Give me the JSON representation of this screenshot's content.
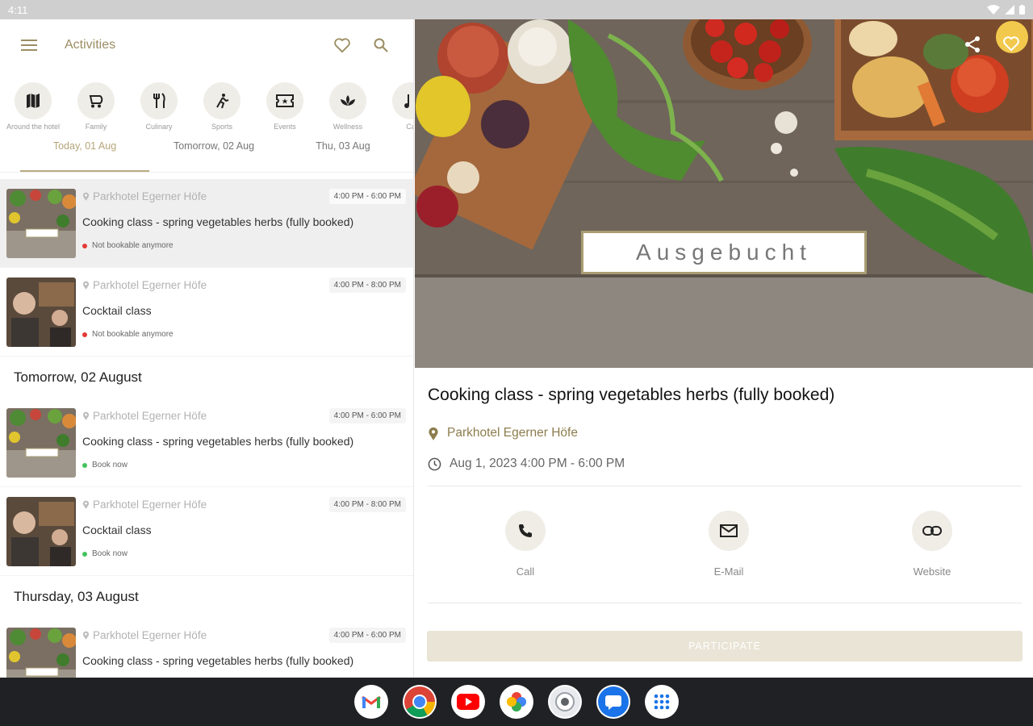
{
  "status_bar": {
    "time": "4:11",
    "icons": [
      "wifi-icon",
      "signal-icon",
      "battery-icon"
    ]
  },
  "header": {
    "title": "Activities",
    "icons": [
      "menu-icon",
      "heart-icon",
      "search-icon"
    ]
  },
  "categories": [
    {
      "label": "Around the hotel",
      "icon": "map-icon"
    },
    {
      "label": "Family",
      "icon": "stroller-icon"
    },
    {
      "label": "Culinary",
      "icon": "cutlery-icon"
    },
    {
      "label": "Sports",
      "icon": "runner-icon"
    },
    {
      "label": "Events",
      "icon": "ticket-icon"
    },
    {
      "label": "Wellness",
      "icon": "lotus-icon"
    },
    {
      "label": "Ca",
      "icon": "music-icon"
    }
  ],
  "day_tabs": [
    "Today, 01 Aug",
    "Tomorrow, 02 Aug",
    "Thu, 03 Aug"
  ],
  "list": {
    "items": [
      {
        "location": "Parkhotel Egerner Höfe",
        "time": "4:00 PM - 6:00 PM",
        "title": "Cooking class - spring vegetables herbs (fully booked)",
        "status": "Not bookable anymore"
      },
      {
        "location": "Parkhotel Egerner Höfe",
        "time": "4:00 PM - 8:00 PM",
        "title": "Cocktail class",
        "status": "Not bookable anymore"
      },
      {
        "location": "Parkhotel Egerner Höfe",
        "time": "4:00 PM - 6:00 PM",
        "title": "Cooking class - spring vegetables herbs (fully booked)",
        "status": "Book now"
      },
      {
        "location": "Parkhotel Egerner Höfe",
        "time": "4:00 PM - 8:00 PM",
        "title": "Cocktail class",
        "status": "Book now"
      },
      {
        "location": "Parkhotel Egerner Höfe",
        "time": "4:00 PM - 6:00 PM",
        "title": "Cooking class - spring vegetables herbs (fully booked)",
        "status": ""
      }
    ],
    "sections": [
      "Tomorrow, 02 August",
      "Thursday, 03 August"
    ]
  },
  "detail": {
    "banner_text": "Ausgebucht",
    "title": "Cooking class - spring vegetables herbs (fully booked)",
    "location": "Parkhotel Egerner Höfe",
    "datetime": "Aug 1, 2023 4:00 PM - 6:00 PM",
    "actions": [
      "Call",
      "E-Mail",
      "Website"
    ],
    "participate_label": "PARTICIPATE"
  },
  "taskbar": {
    "apps": [
      "gmail-icon",
      "chrome-icon",
      "youtube-icon",
      "photos-icon",
      "camera-icon",
      "messages-icon",
      "app-launcher-icon"
    ]
  },
  "colors": {
    "accent": "#9b8d63",
    "selected_row": "#efefef",
    "icon_bg": "#efede7",
    "participate_bg": "#e9e4d5",
    "taskbar_bg": "#202124",
    "status_red": "#e53935",
    "status_green": "#43c35e"
  }
}
